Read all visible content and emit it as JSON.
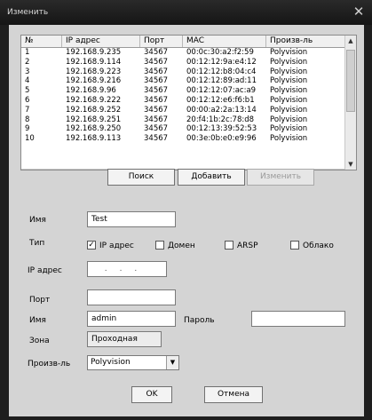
{
  "window": {
    "title": "Изменить"
  },
  "list": {
    "columns": [
      "№",
      "IP адрес",
      "Порт",
      "MAC",
      "Произв-ль"
    ],
    "rows": [
      [
        "1",
        "192.168.9.235",
        "34567",
        "00:0c:30:a2:f2:59",
        "Polyvision"
      ],
      [
        "2",
        "192.168.9.114",
        "34567",
        "00:12:12:9a:e4:12",
        "Polyvision"
      ],
      [
        "3",
        "192.168.9.223",
        "34567",
        "00:12:12:b8:04:c4",
        "Polyvision"
      ],
      [
        "4",
        "192.168.9.216",
        "34567",
        "00:12:12:89:ad:11",
        "Polyvision"
      ],
      [
        "5",
        "192.168.9.96",
        "34567",
        "00:12:12:07:ac:a9",
        "Polyvision"
      ],
      [
        "6",
        "192.168.9.222",
        "34567",
        "00:12:12:e6:f6:b1",
        "Polyvision"
      ],
      [
        "7",
        "192.168.9.252",
        "34567",
        "00:00:a2:2a:13:14",
        "Polyvision"
      ],
      [
        "8",
        "192.168.9.251",
        "34567",
        "20:f4:1b:2c:78:d8",
        "Polyvision"
      ],
      [
        "9",
        "192.168.9.250",
        "34567",
        "00:12:13:39:52:53",
        "Polyvision"
      ],
      [
        "10",
        "192.168.9.113",
        "34567",
        "00:3e:0b:e0:e9:96",
        "Polyvision"
      ]
    ]
  },
  "buttons": {
    "search": "Поиск",
    "add": "Добавить",
    "edit": "Изменить",
    "ok": "OK",
    "cancel": "Отмена"
  },
  "form": {
    "name_label": "Имя",
    "name_value": "Test",
    "type_label": "Тип",
    "type_options": [
      {
        "label": "IP адрес",
        "checked": true
      },
      {
        "label": "Домен",
        "checked": false
      },
      {
        "label": "ARSP",
        "checked": false
      },
      {
        "label": "Облако",
        "checked": false
      }
    ],
    "ip_label": "IP адрес",
    "port_label": "Порт",
    "port_value": "",
    "user_label": "Имя",
    "user_value": "admin",
    "password_label": "Пароль",
    "password_value": "",
    "zone_label": "Зона",
    "zone_value": "Проходная",
    "vendor_label": "Произв-ль",
    "vendor_value": "Polyvision"
  },
  "icons": {
    "close": "close-icon",
    "scroll_up": "arrow-up-icon",
    "scroll_down": "arrow-down-icon",
    "dropdown": "chevron-down-icon",
    "check": "checkmark-icon"
  }
}
